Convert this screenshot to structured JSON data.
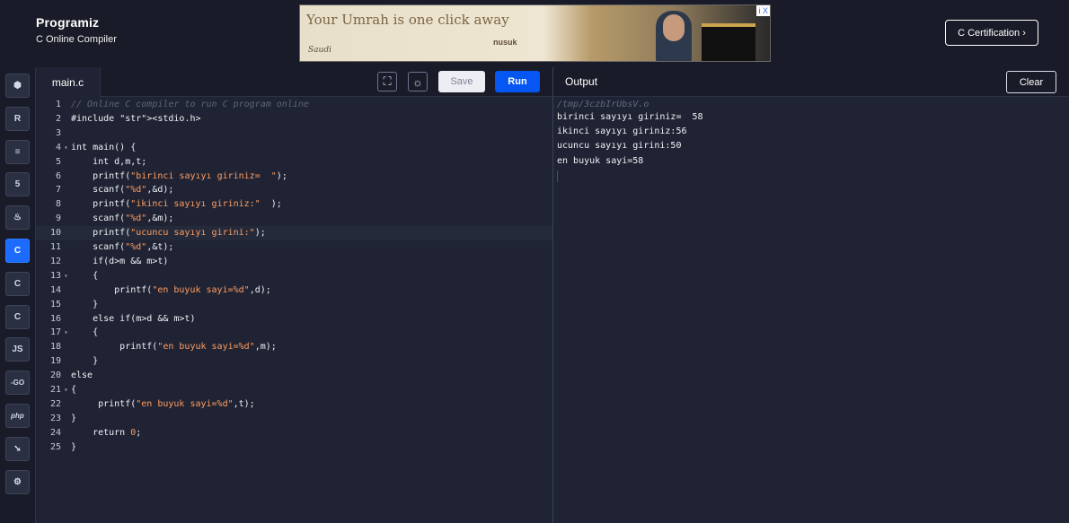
{
  "header": {
    "brand": "Programiz",
    "subtitle": "C Online Compiler",
    "ad_headline": "Your Umrah is one click away",
    "ad_brand_left": "Saudi",
    "ad_brand_right": "nusuk",
    "ad_info": "i X",
    "cert_button": "C Certification ›"
  },
  "sidebar": {
    "items": [
      {
        "icon": "python-icon",
        "glyph": "⬢"
      },
      {
        "icon": "r-icon",
        "glyph": "R"
      },
      {
        "icon": "sql-icon",
        "glyph": "≡"
      },
      {
        "icon": "html5-icon",
        "glyph": "5"
      },
      {
        "icon": "java-icon",
        "glyph": "♨"
      },
      {
        "icon": "c-icon",
        "glyph": "C",
        "active": true
      },
      {
        "icon": "cpp-icon",
        "glyph": "C"
      },
      {
        "icon": "csharp-icon",
        "glyph": "C"
      },
      {
        "icon": "javascript-icon",
        "glyph": "JS"
      },
      {
        "icon": "go-icon",
        "glyph": "-GO"
      },
      {
        "icon": "php-icon",
        "glyph": "php"
      },
      {
        "icon": "swift-icon",
        "glyph": "➘"
      },
      {
        "icon": "rust-icon",
        "glyph": "⚙"
      }
    ]
  },
  "editor": {
    "tab": "main.c",
    "save": "Save",
    "run": "Run",
    "lines": [
      "// Online C compiler to run C program online",
      "#include <stdio.h>",
      "",
      "int main() {",
      "    int d,m,t;",
      "    printf(\"birinci sayıyı giriniz=  \");",
      "    scanf(\"%d\",&d);",
      "    printf(\"ikinci sayıyı giriniz:\"  );",
      "    scanf(\"%d\",&m);",
      "    printf(\"ucuncu sayıyı girini:\");",
      "    scanf(\"%d\",&t);",
      "    if(d>m && m>t)",
      "    {",
      "        printf(\"en buyuk sayi=%d\",d);",
      "    }",
      "    else if(m>d && m>t)",
      "    {",
      "         printf(\"en buyuk sayi=%d\",m);",
      "    }",
      "else",
      "{",
      "     printf(\"en buyuk sayi=%d\",t);",
      "}",
      "    return 0;",
      "}"
    ]
  },
  "output": {
    "title": "Output",
    "clear": "Clear",
    "path": "/tmp/3czbIrUbsV.o",
    "lines": [
      "birinci sayıyı giriniz=  58",
      "ikinci sayıyı giriniz:56",
      "ucuncu sayıyı girini:50",
      "en buyuk sayi=58"
    ]
  }
}
